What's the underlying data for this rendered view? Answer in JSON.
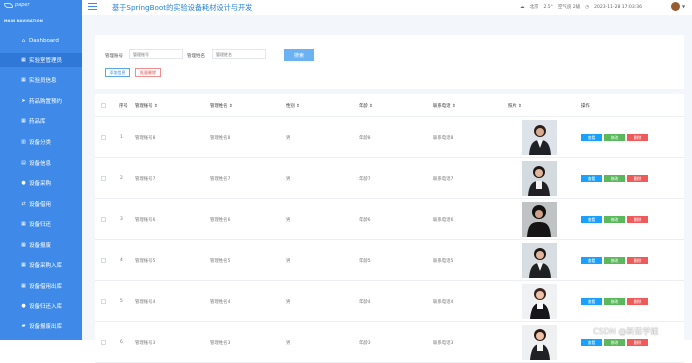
{
  "app": {
    "logo_text": "paper",
    "title": "基于SpringBoot的实验设备耗材设计与开发"
  },
  "top_status": {
    "weather": "北京",
    "temp": "2.5°",
    "aqi_label": "空气良 2级",
    "datetime": "2023-11-28 17:03:36",
    "colors": {
      "accent": "#3f8ae8",
      "title": "#2683df"
    }
  },
  "sidebar": {
    "section_label": "MAIN NAVIGATION",
    "items": [
      {
        "label": "Dashboard",
        "icon": "home-icon"
      },
      {
        "label": "实验室管理员",
        "icon": "table-icon"
      },
      {
        "label": "实验员信息",
        "icon": "grid-icon"
      },
      {
        "label": "药品购置预约",
        "icon": "send-icon"
      },
      {
        "label": "药品库",
        "icon": "grid-icon"
      },
      {
        "label": "设备分类",
        "icon": "category-icon"
      },
      {
        "label": "设备信息",
        "icon": "list-icon"
      },
      {
        "label": "设备采购",
        "icon": "person-icon"
      },
      {
        "label": "设备借用",
        "icon": "arrows-icon"
      },
      {
        "label": "设备归还",
        "icon": "grid-icon"
      },
      {
        "label": "设备报废",
        "icon": "grid-icon"
      },
      {
        "label": "设备采购入库",
        "icon": "grid-icon"
      },
      {
        "label": "设备借用出库",
        "icon": "grid-icon"
      },
      {
        "label": "设备归还入库",
        "icon": "pin-icon"
      },
      {
        "label": "设备报废出库",
        "icon": "folder-icon"
      }
    ]
  },
  "search": {
    "account_label": "管理账号",
    "account_placeholder": "管理账号",
    "name_label": "管理姓名",
    "name_placeholder": "管理姓名",
    "search_button": "搜索",
    "add_button": "添加信息",
    "batch_delete_button": "批量删除"
  },
  "table": {
    "headers": [
      "序号",
      "管理账号 ⇕",
      "管理姓名 ⇕",
      "性别 ⇕",
      "年龄 ⇕",
      "联系电话 ⇕",
      "照片 ⇕",
      "操作"
    ],
    "actions": [
      "查看",
      "修改",
      "删除"
    ],
    "rows": [
      {
        "index": "1",
        "account": "管理账号8",
        "name": "管理姓名8",
        "gender": "男",
        "age": "年龄8",
        "phone": "联系电话8",
        "photo": "portrait-1"
      },
      {
        "index": "2",
        "account": "管理账号7",
        "name": "管理姓名7",
        "gender": "男",
        "age": "年龄7",
        "phone": "联系电话7",
        "photo": "portrait-2"
      },
      {
        "index": "3",
        "account": "管理账号6",
        "name": "管理姓名6",
        "gender": "男",
        "age": "年龄6",
        "phone": "联系电话6",
        "photo": "portrait-3"
      },
      {
        "index": "4",
        "account": "管理账号5",
        "name": "管理姓名5",
        "gender": "男",
        "age": "年龄5",
        "phone": "联系电话5",
        "photo": "portrait-4"
      },
      {
        "index": "5",
        "account": "管理账号4",
        "name": "管理姓名4",
        "gender": "男",
        "age": "年龄4",
        "phone": "联系电话4",
        "photo": "portrait-5"
      },
      {
        "index": "6",
        "account": "管理账号3",
        "name": "管理姓名3",
        "gender": "男",
        "age": "年龄3",
        "phone": "联系电话3",
        "photo": "portrait-6"
      }
    ]
  },
  "watermark": "CSDN @新茹学姐"
}
